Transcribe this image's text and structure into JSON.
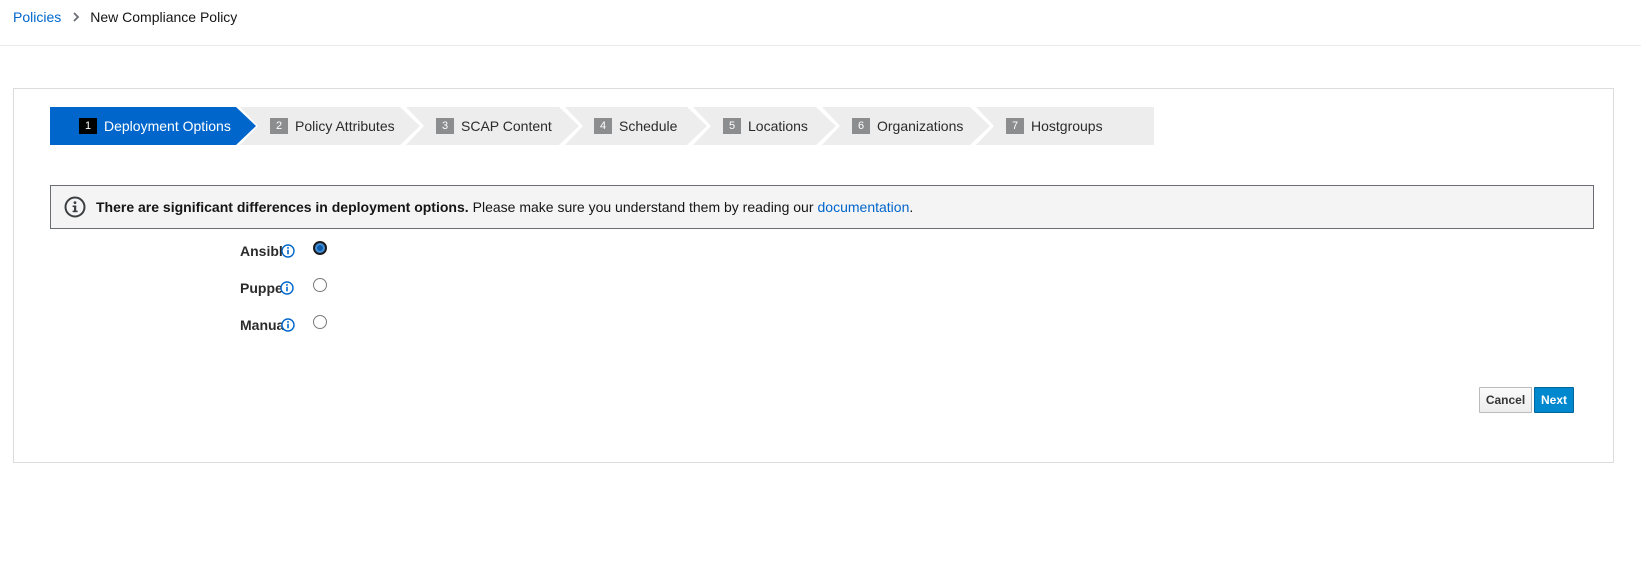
{
  "breadcrumb": {
    "parent": "Policies",
    "current": "New Compliance Policy"
  },
  "wizard": {
    "steps": [
      {
        "number": "1",
        "label": "Deployment Options",
        "active": true
      },
      {
        "number": "2",
        "label": "Policy Attributes",
        "active": false
      },
      {
        "number": "3",
        "label": "SCAP Content",
        "active": false
      },
      {
        "number": "4",
        "label": "Schedule",
        "active": false
      },
      {
        "number": "5",
        "label": "Locations",
        "active": false
      },
      {
        "number": "6",
        "label": "Organizations",
        "active": false
      },
      {
        "number": "7",
        "label": "Hostgroups",
        "active": false
      }
    ]
  },
  "alert": {
    "bold": "There are significant differences in deployment options.",
    "text": "Please make sure you understand them by reading our",
    "link": "documentation",
    "trailing": "."
  },
  "deployment": {
    "options": [
      {
        "label": "Ansible",
        "selected": true
      },
      {
        "label": "Puppet",
        "selected": false
      },
      {
        "label": "Manual",
        "selected": false
      }
    ]
  },
  "actions": {
    "cancel_label": "Cancel",
    "next_label": "Next"
  },
  "colors": {
    "active_step": "#0066cc",
    "inactive_step": "#ededed",
    "link": "#0066cc",
    "primary_button": "#0088ce"
  },
  "icons": {
    "breadcrumb_separator": "chevron-right-icon",
    "alert": "info-circle-icon",
    "help": "info-circle-icon"
  }
}
